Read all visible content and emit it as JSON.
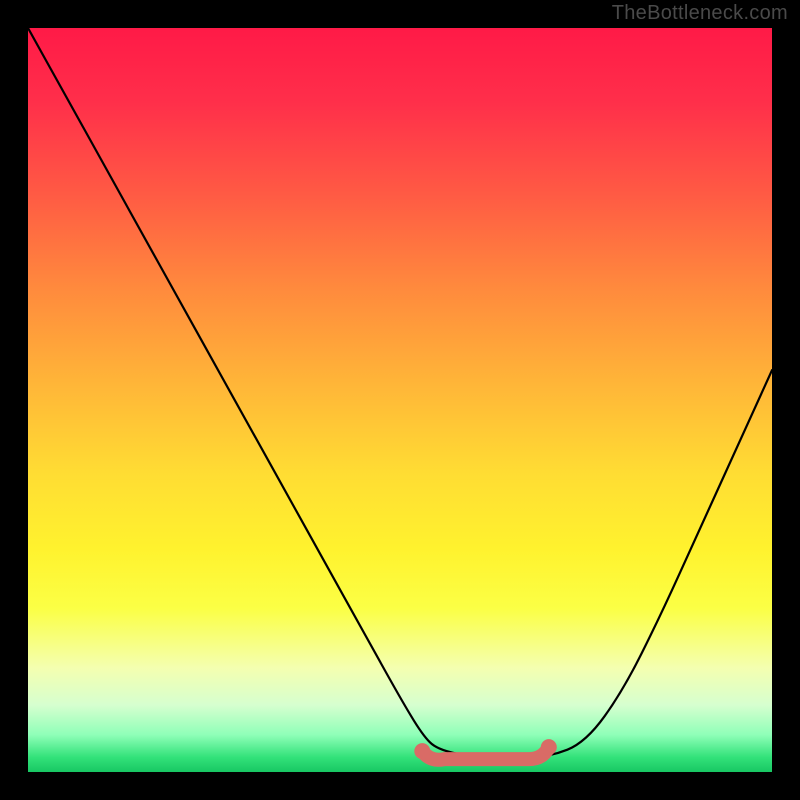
{
  "watermark": "TheBottleneck.com",
  "colors": {
    "background": "#000000",
    "curve": "#000000",
    "flat_segment": "#d96b66",
    "gradient_top": "#ff1a47",
    "gradient_bottom": "#18c763"
  },
  "chart_data": {
    "type": "line",
    "title": "",
    "xlabel": "",
    "ylabel": "",
    "xlim": [
      0,
      100
    ],
    "ylim": [
      0,
      100
    ],
    "x": [
      0,
      5,
      10,
      15,
      20,
      25,
      30,
      35,
      40,
      45,
      50,
      53,
      55,
      60,
      65,
      70,
      75,
      80,
      85,
      90,
      95,
      100
    ],
    "values": [
      100,
      91,
      82,
      73,
      64,
      55,
      46,
      37,
      28,
      19,
      10,
      5,
      3,
      2,
      2,
      2,
      4,
      11,
      21,
      32,
      43,
      54
    ],
    "flat_segment_x": [
      53,
      70
    ],
    "flat_segment_y": 2,
    "annotations": []
  }
}
